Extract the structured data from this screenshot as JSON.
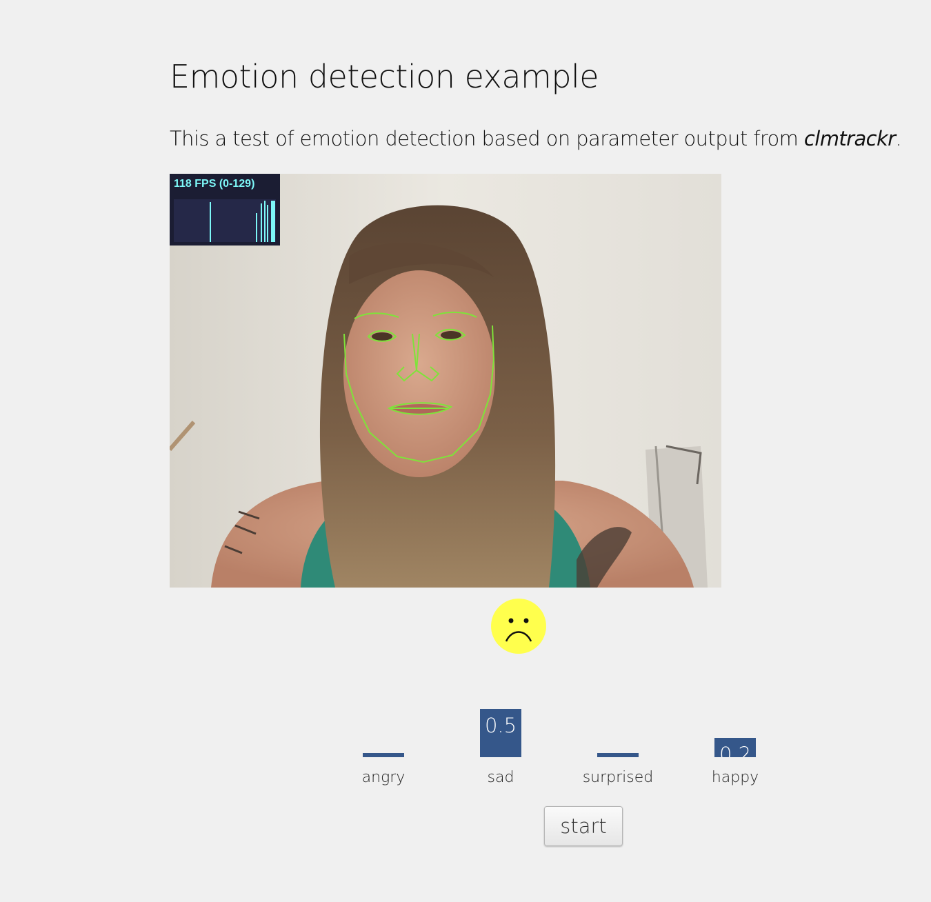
{
  "page": {
    "title": "Emotion detection example",
    "intro_prefix": "This a test of emotion detection based on parameter output from ",
    "intro_link": "clmtrackr",
    "intro_suffix": "."
  },
  "fps_meter": {
    "label": "118 FPS (0-129)",
    "text_color": "#7df7f7",
    "background": "#1b1d33"
  },
  "emoji": {
    "icon": "sad-face-icon",
    "color": "#ffff4d"
  },
  "emotion_chart": {
    "bar_color": "#35578a",
    "items": [
      {
        "label": "angry",
        "value": "0.0",
        "level": 0.0
      },
      {
        "label": "sad",
        "value": "0.5",
        "level": 0.5
      },
      {
        "label": "surprised",
        "value": "0.0",
        "level": 0.0
      },
      {
        "label": "happy",
        "value": "0.2",
        "level": 0.2
      }
    ]
  },
  "controls": {
    "start_label": "start"
  },
  "tracker": {
    "overlay_color": "#7fe33a"
  }
}
